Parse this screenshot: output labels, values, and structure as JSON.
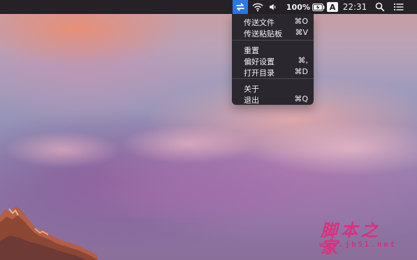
{
  "menubar": {
    "battery_percent": "100%",
    "input_source": "A",
    "clock": "22:31",
    "icons": {
      "app": "transfer-icon",
      "wifi": "wifi-icon",
      "volume": "volume-icon",
      "battery": "battery-charging-icon",
      "search": "search-icon",
      "notifications": "list-icon"
    }
  },
  "menu": {
    "items": [
      {
        "label": "传送文件",
        "shortcut": "⌘O"
      },
      {
        "label": "传送粘贴板",
        "shortcut": "⌘V"
      },
      {
        "label": "重置",
        "shortcut": ""
      },
      {
        "label": "偏好设置",
        "shortcut": "⌘,"
      },
      {
        "label": "打开目录",
        "shortcut": "⌘D"
      },
      {
        "label": "关于",
        "shortcut": ""
      },
      {
        "label": "退出",
        "shortcut": "⌘Q"
      }
    ]
  },
  "watermark": {
    "title": "脚本之家",
    "url": "www.jb51.net"
  },
  "colors": {
    "menubar_bg": "#1e1c22",
    "menu_bg": "#24222a",
    "app_icon_bg": "#2b78e7",
    "watermark": "#dc2f7e"
  }
}
